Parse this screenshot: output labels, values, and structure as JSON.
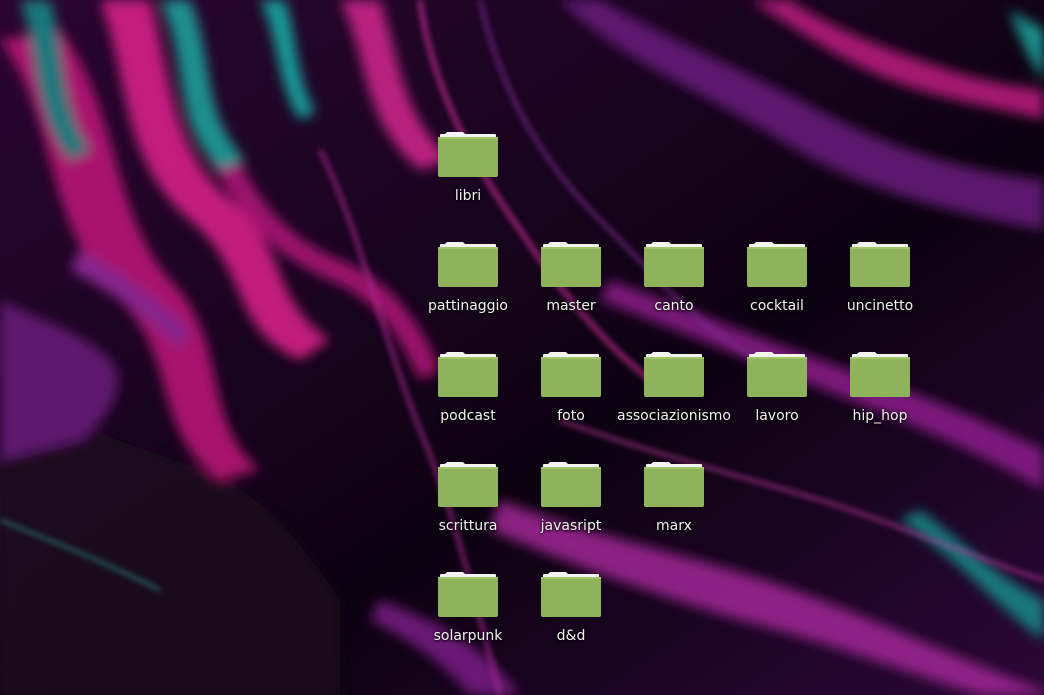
{
  "desktop": {
    "colors": {
      "folder_body": "#8fb35a",
      "folder_tab": "#f4f4f4",
      "label_text": "#f2f2f2"
    },
    "folders": [
      {
        "label": "libri",
        "icon": "folder-icon"
      },
      {
        "label": "pattinaggio",
        "icon": "folder-icon"
      },
      {
        "label": "master",
        "icon": "folder-icon"
      },
      {
        "label": "canto",
        "icon": "folder-icon"
      },
      {
        "label": "cocktail",
        "icon": "folder-icon"
      },
      {
        "label": "uncinetto",
        "icon": "folder-icon"
      },
      {
        "label": "podcast",
        "icon": "folder-icon"
      },
      {
        "label": "foto",
        "icon": "folder-icon"
      },
      {
        "label": "associazionismo",
        "icon": "folder-icon"
      },
      {
        "label": "lavoro",
        "icon": "folder-icon"
      },
      {
        "label": "hip_hop",
        "icon": "folder-icon"
      },
      {
        "label": "scrittura",
        "icon": "folder-icon"
      },
      {
        "label": "javasript",
        "icon": "folder-icon"
      },
      {
        "label": "marx",
        "icon": "folder-icon"
      },
      {
        "label": "solarpunk",
        "icon": "folder-icon"
      },
      {
        "label": "d&d",
        "icon": "folder-icon"
      }
    ]
  }
}
